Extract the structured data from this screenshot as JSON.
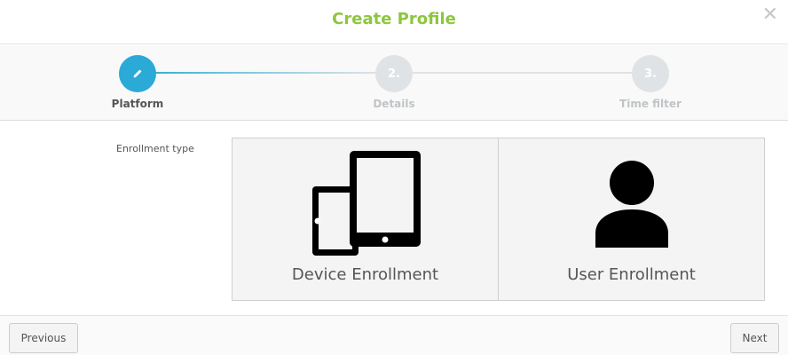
{
  "modal": {
    "title": "Create Profile",
    "close_glyph": "✕"
  },
  "stepper": {
    "steps": [
      {
        "label": "Platform",
        "marker": "",
        "icon": "pencil-icon",
        "state": "active"
      },
      {
        "label": "Details",
        "marker": "2.",
        "state": "pending"
      },
      {
        "label": "Time filter",
        "marker": "3.",
        "state": "pending"
      }
    ]
  },
  "form": {
    "field_label": "Enrollment type",
    "options": [
      {
        "label": "Device Enrollment",
        "icon": "tablet-phone-icon"
      },
      {
        "label": "User Enrollment",
        "icon": "user-icon"
      }
    ]
  },
  "footer": {
    "previous_label": "Previous",
    "next_label": "Next"
  },
  "colors": {
    "title_green": "#8dc63f",
    "active_step_blue": "#2ba9d7",
    "inactive_step_gray": "#dfe3e5"
  }
}
